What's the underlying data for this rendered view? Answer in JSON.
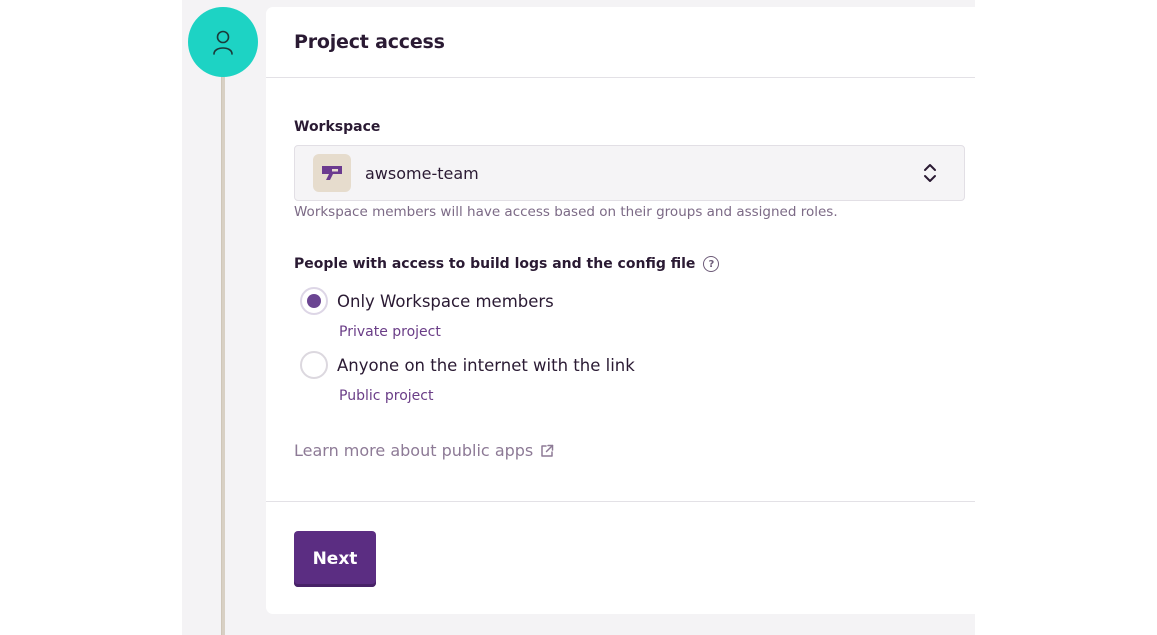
{
  "card": {
    "title": "Project access"
  },
  "workspace": {
    "label": "Workspace",
    "selected": "awsome-team",
    "help": "Workspace members will have access based on their groups and assigned roles."
  },
  "access": {
    "label": "People with access to build logs and the config file",
    "help_icon": "question-circle-icon",
    "options": [
      {
        "label": "Only Workspace members",
        "sublabel": "Private project",
        "checked": true
      },
      {
        "label": "Anyone on the internet with the link",
        "sublabel": "Public project",
        "checked": false
      }
    ]
  },
  "learn_more": {
    "text": "Learn more about public apps",
    "icon": "external-link-icon"
  },
  "actions": {
    "next_label": "Next"
  },
  "colors": {
    "step_circle": "#1dd3c4",
    "brand_purple": "#5b2d82",
    "link_purple": "#6a3d87"
  }
}
